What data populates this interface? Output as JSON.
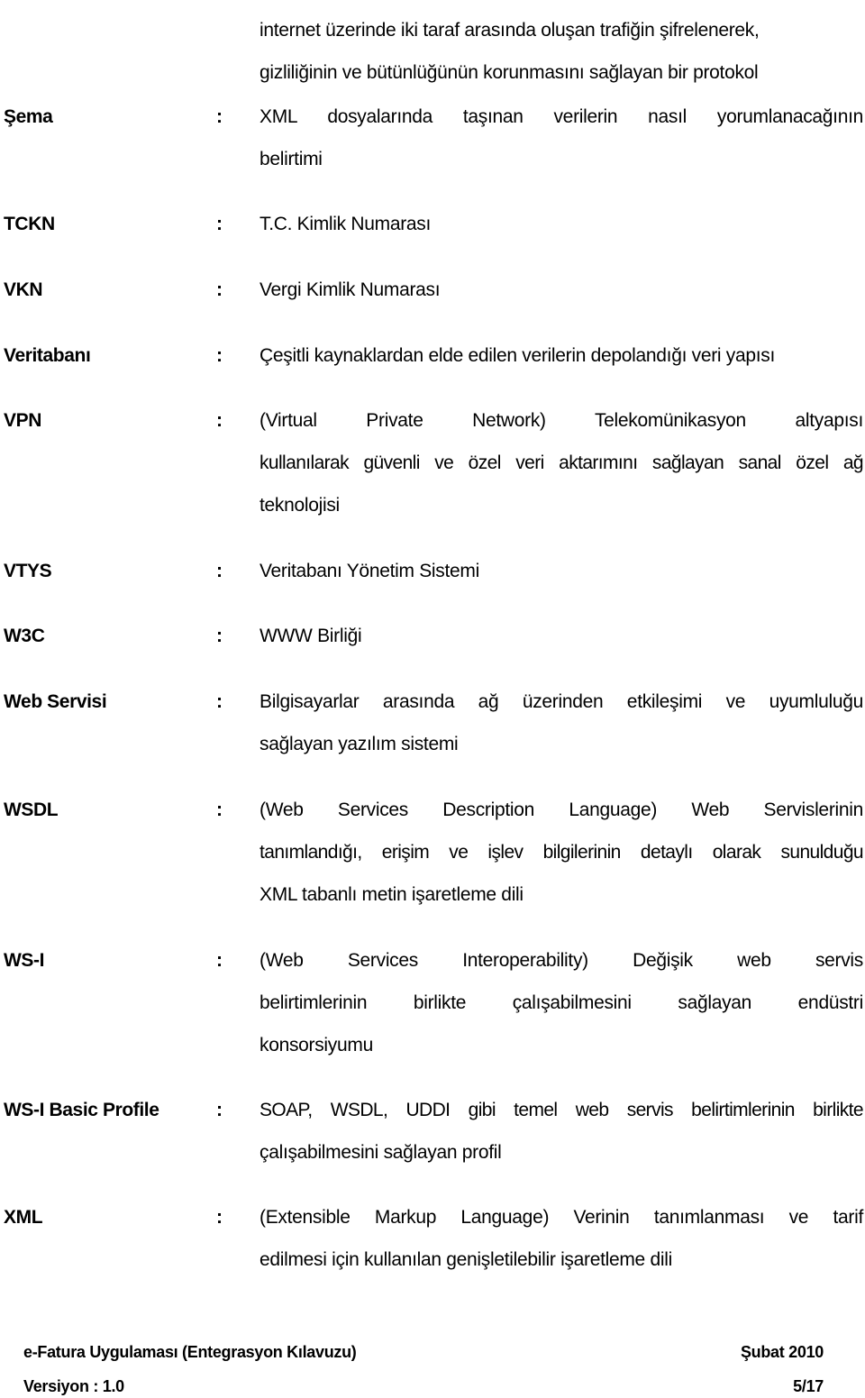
{
  "continuation": {
    "lines": [
      "internet üzerinde iki taraf arasında oluşan trafiğin şifrelenerek,",
      "gizliliğinin ve bütünlüğünün korunmasını sağlayan bir protokol"
    ]
  },
  "separator": ":",
  "glossary": [
    {
      "term": "Şema",
      "lines": [
        "XML dosyalarında taşınan verilerin nasıl yorumlanacağının",
        "belirtimi"
      ]
    },
    {
      "term": "TCKN",
      "lines": [
        "T.C. Kimlik Numarası"
      ]
    },
    {
      "term": "VKN",
      "lines": [
        "Vergi Kimlik Numarası"
      ]
    },
    {
      "term": "Veritabanı",
      "lines": [
        "Çeşitli kaynaklardan elde edilen verilerin depolandığı veri yapısı"
      ]
    },
    {
      "term": "VPN",
      "lines": [
        "(Virtual Private Network) Telekomünikasyon altyapısı",
        "kullanılarak güvenli ve özel veri aktarımını sağlayan sanal özel ağ",
        "teknolojisi"
      ]
    },
    {
      "term": "VTYS",
      "lines": [
        "Veritabanı Yönetim Sistemi"
      ]
    },
    {
      "term": "W3C",
      "lines": [
        "WWW Birliği"
      ]
    },
    {
      "term": "Web Servisi",
      "lines": [
        "Bilgisayarlar arasında ağ üzerinden etkileşimi ve uyumluluğu",
        "sağlayan yazılım sistemi"
      ]
    },
    {
      "term": "WSDL",
      "lines": [
        "(Web Services Description Language) Web Servislerinin",
        "tanımlandığı, erişim ve işlev bilgilerinin detaylı olarak sunulduğu",
        "XML tabanlı metin işaretleme dili"
      ]
    },
    {
      "term": "WS-I",
      "lines": [
        "(Web Services Interoperability) Değişik web servis",
        "belirtimlerinin birlikte çalışabilmesini sağlayan endüstri",
        "konsorsiyumu"
      ]
    },
    {
      "term": "WS-I Basic Profile",
      "lines": [
        "SOAP, WSDL, UDDI gibi temel web servis belirtimlerinin birlikte",
        "çalışabilmesini sağlayan profil"
      ]
    },
    {
      "term": "XML",
      "lines": [
        "(Extensible Markup Language) Verinin tanımlanması ve tarif",
        "edilmesi için kullanılan genişletilebilir işaretleme dili"
      ]
    }
  ],
  "footer": {
    "document_title": "e-Fatura Uygulaması (Entegrasyon Kılavuzu)",
    "date": "Şubat 2010",
    "version": "Versiyon : 1.0",
    "page_number": "5/17"
  }
}
